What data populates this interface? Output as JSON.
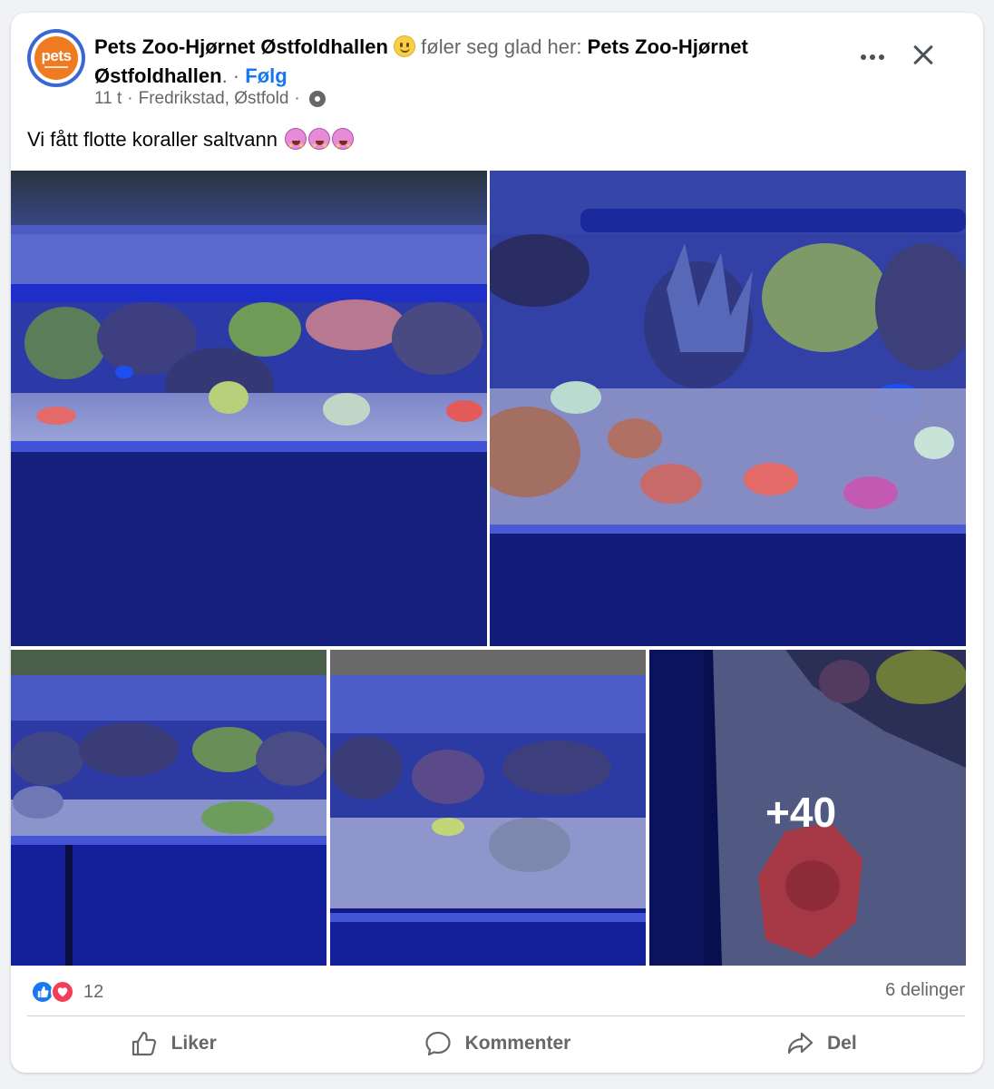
{
  "post": {
    "author": "Pets Zoo-Hjørnet Østfoldhallen",
    "feeling_text": "føler seg glad her:",
    "place": "Pets Zoo-Hjørnet Østfoldhallen",
    "separator": ". ·",
    "follow_label": "Følg",
    "avatar_text": "pets",
    "time": "11 t",
    "dot": "·",
    "location": "Fredrikstad, Østfold",
    "text": "Vi fått flotte koraller saltvann",
    "more_photos": "+40"
  },
  "stats": {
    "reaction_count": "12",
    "shares": "6 delinger"
  },
  "actions": {
    "like": "Liker",
    "comment": "Kommenter",
    "share": "Del"
  },
  "icons": {
    "more": "more-options-icon",
    "close": "close-icon",
    "privacy": "gear-icon",
    "like": "thumbs-up-icon",
    "comment": "speech-bubble-icon",
    "share": "share-arrow-icon"
  },
  "colors": {
    "accent": "#1877f2",
    "secondary_text": "#65676b",
    "love": "#f33e58",
    "brand_orange": "#ef7a22"
  }
}
